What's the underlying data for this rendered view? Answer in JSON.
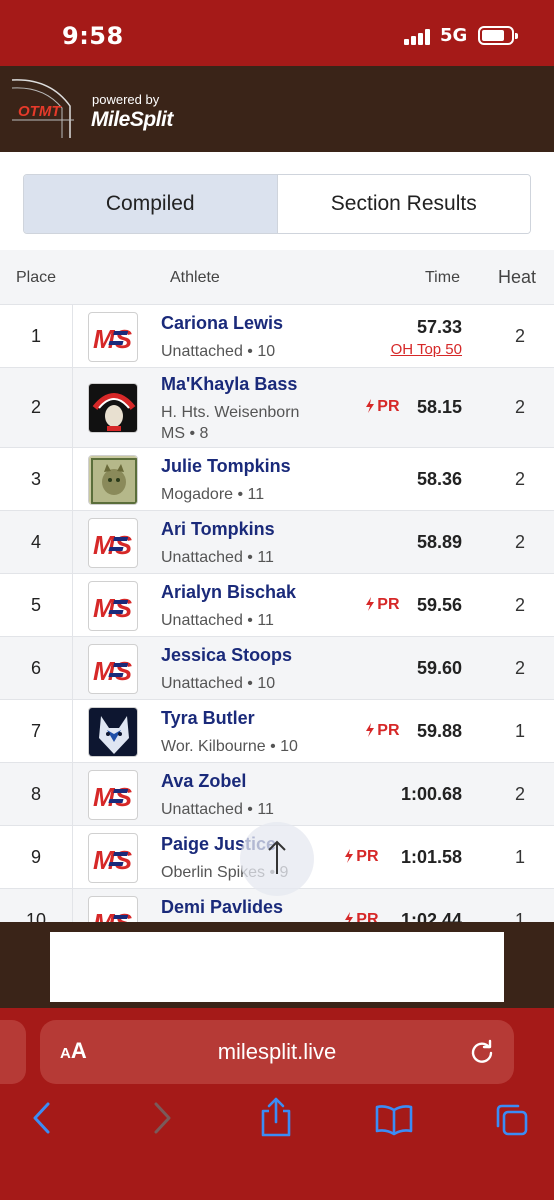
{
  "status_bar": {
    "time": "9:58",
    "network": "5G"
  },
  "brand": {
    "logo_text": "OTMT",
    "powered_by": "powered by",
    "name": "MileSplit",
    "logo_ms": "MS"
  },
  "tabs": [
    {
      "label": "Compiled",
      "active": true
    },
    {
      "label": "Section Results",
      "active": false
    }
  ],
  "table": {
    "headers": {
      "place": "Place",
      "athlete": "Athlete",
      "time": "Time",
      "heat": "Heat"
    },
    "pr_label": "PR",
    "rows": [
      {
        "place": "1",
        "name": "Cariona Lewis",
        "team": "Unattached • 10",
        "time": "57.33",
        "pr": false,
        "ranking": "OH Top 50",
        "heat": "2",
        "logo": "ms-logo"
      },
      {
        "place": "2",
        "name": "Ma'Khayla Bass",
        "team": "H. Hts. Weisenborn MS • 8",
        "time": "58.15",
        "pr": true,
        "heat": "2",
        "logo": "indian-head-logo"
      },
      {
        "place": "3",
        "name": "Julie Tompkins",
        "team": "Mogadore • 11",
        "time": "58.36",
        "pr": false,
        "heat": "2",
        "logo": "wildcats-logo"
      },
      {
        "place": "4",
        "name": "Ari Tompkins",
        "team": "Unattached • 11",
        "time": "58.89",
        "pr": false,
        "heat": "2",
        "logo": "ms-logo"
      },
      {
        "place": "5",
        "name": "Arialyn Bischak",
        "team": "Unattached • 11",
        "time": "59.56",
        "pr": true,
        "heat": "2",
        "logo": "ms-logo"
      },
      {
        "place": "6",
        "name": "Jessica Stoops",
        "team": "Unattached • 10",
        "time": "59.60",
        "pr": false,
        "heat": "2",
        "logo": "ms-logo"
      },
      {
        "place": "7",
        "name": "Tyra Butler",
        "team": "Wor. Kilbourne • 10",
        "time": "59.88",
        "pr": true,
        "heat": "1",
        "logo": "wolf-logo"
      },
      {
        "place": "8",
        "name": "Ava Zobel",
        "team": "Unattached • 11",
        "time": "1:00.68",
        "pr": false,
        "heat": "2",
        "logo": "ms-logo"
      },
      {
        "place": "9",
        "name": "Paige Justice",
        "team": "Oberlin Spikes • 9",
        "time": "1:01.58",
        "pr": true,
        "heat": "1",
        "logo": "ms-logo"
      },
      {
        "place": "10",
        "name": "Demi Pavlides",
        "team": "",
        "time": "1:02.44",
        "pr": true,
        "heat": "1",
        "logo": "ms-logo"
      }
    ]
  },
  "browser": {
    "aa_label": "AA",
    "url": "milesplit.live"
  },
  "colors": {
    "header_red": "#a51a18",
    "brand_brown": "#3a2418",
    "name_blue": "#1a2a7a",
    "pr_red": "#d62828"
  }
}
